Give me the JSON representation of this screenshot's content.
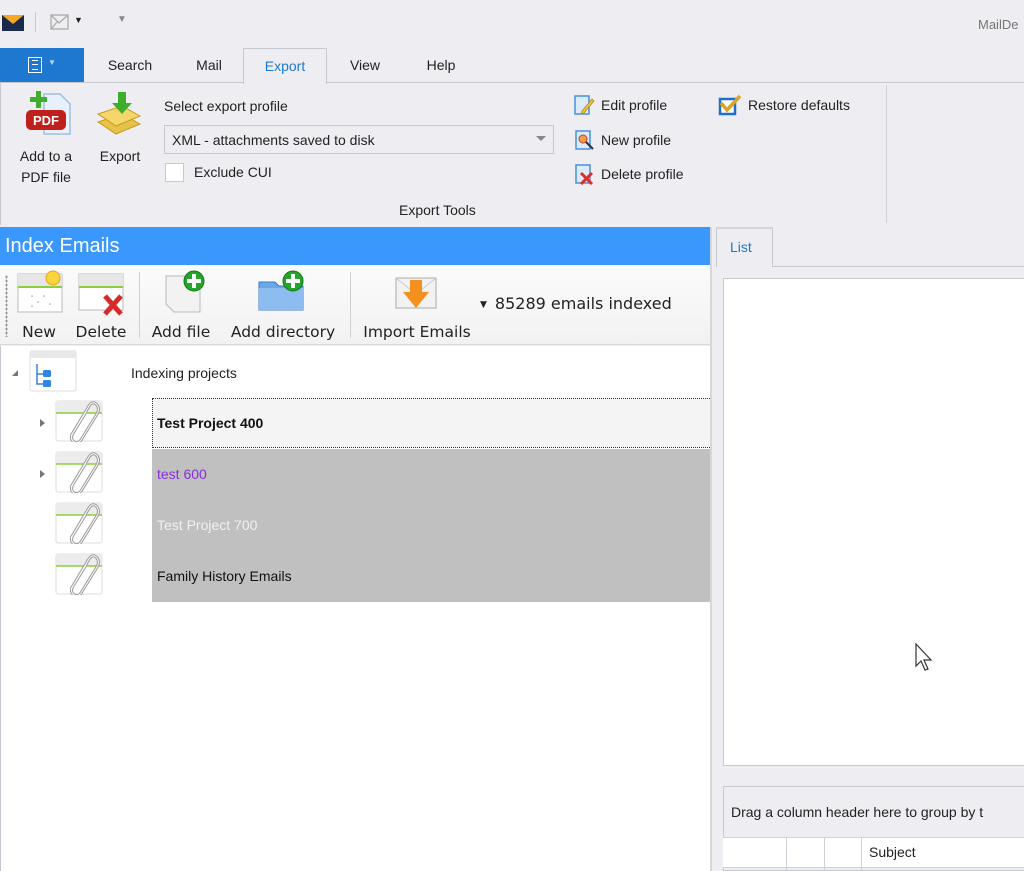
{
  "window": {
    "title": "MailDe",
    "quick_access": {
      "logo_icon": "envelope-logo-icon",
      "email_icon": "email-outline-icon",
      "customize_icon": "customize-toolbar-icon"
    }
  },
  "ribbon": {
    "file_tab_icon": "application-menu-icon",
    "tabs": [
      {
        "label": "Search",
        "active": false
      },
      {
        "label": "Mail",
        "active": false
      },
      {
        "label": "Export",
        "active": true
      },
      {
        "label": "View",
        "active": false
      },
      {
        "label": "Help",
        "active": false
      }
    ],
    "export_group": {
      "add_pdf": {
        "line1": "Add to a",
        "line2": "PDF file",
        "icon": "pdf-add-icon"
      },
      "export": {
        "label": "Export",
        "icon": "export-stack-icon"
      },
      "profile_label": "Select export profile",
      "profile_value": "XML - attachments saved to disk",
      "exclude_cui": {
        "label": "Exclude CUI",
        "checked": false
      },
      "edit_profile": "Edit profile",
      "new_profile": "New profile",
      "delete_profile": "Delete profile",
      "restore_defaults": "Restore defaults",
      "group_label": "Export Tools"
    }
  },
  "index_panel": {
    "title": "Index Emails",
    "toolbar": {
      "new": "New",
      "delete": "Delete",
      "add_file": "Add file",
      "add_directory": "Add directory",
      "import_emails": "Import Emails",
      "email_count": "85289 emails indexed"
    },
    "tree": {
      "root": {
        "label": "Indexing projects",
        "expanded": true
      },
      "projects": [
        {
          "label": "Test Project 400",
          "has_children": true,
          "state": "focused",
          "text_color": "#111111"
        },
        {
          "label": "test 600",
          "has_children": true,
          "state": "selected",
          "text_color": "#8a2be2"
        },
        {
          "label": "Test Project 700",
          "has_children": false,
          "state": "selected",
          "text_color": "#f0f0f0"
        },
        {
          "label": "Family History Emails",
          "has_children": false,
          "state": "selected",
          "text_color": "#111111"
        }
      ]
    }
  },
  "right_panel": {
    "tabs": [
      {
        "label": "List",
        "active": true
      }
    ],
    "group_hint": "Drag a column header here to group by t",
    "grid_columns": [
      "",
      "",
      "",
      "Subject"
    ]
  },
  "colors": {
    "accent": "#1e78d0",
    "panel_header": "#3a97fb",
    "selection_grey": "#c0c0c0"
  }
}
